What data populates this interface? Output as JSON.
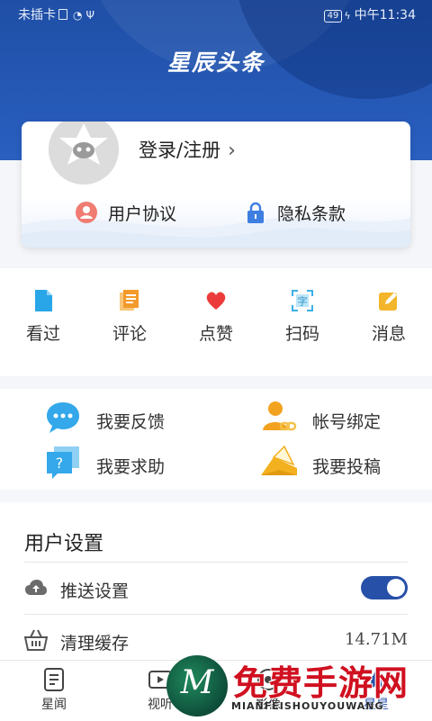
{
  "status_bar": {
    "carrier": "未插卡",
    "battery": "49",
    "time": "中午11:34"
  },
  "header": {
    "logo_text": "星辰头条"
  },
  "profile": {
    "login_label": "登录/注册",
    "links": [
      {
        "label": "用户协议",
        "icon": "user-circle-icon",
        "color": "#f07c72"
      },
      {
        "label": "隐私条款",
        "icon": "lock-icon",
        "color": "#3e7ee0"
      }
    ]
  },
  "quick_actions": [
    {
      "label": "看过",
      "icon": "document-icon",
      "color": "#28a6e8"
    },
    {
      "label": "评论",
      "icon": "comment-doc-icon",
      "color": "#f39a2b"
    },
    {
      "label": "点赞",
      "icon": "heart-icon",
      "color": "#ec3b3b"
    },
    {
      "label": "扫码",
      "icon": "scan-icon",
      "color": "#3ab0e8"
    },
    {
      "label": "消息",
      "icon": "edit-icon",
      "color": "#f3b52b"
    }
  ],
  "services": [
    {
      "label": "我要反馈",
      "icon": "chat-bubble-icon",
      "color": "#34a8ea"
    },
    {
      "label": "帐号绑定",
      "icon": "user-link-icon",
      "color": "#f3a21f"
    },
    {
      "label": "我要求助",
      "icon": "help-icon",
      "color": "#34a8ea"
    },
    {
      "label": "我要投稿",
      "icon": "submit-envelope-icon",
      "color": "#f3b01f"
    }
  ],
  "settings": {
    "title": "用户设置",
    "rows": [
      {
        "label": "推送设置",
        "icon": "cloud-upload-icon",
        "toggle_on": true
      },
      {
        "label": "清理缓存",
        "icon": "basket-icon",
        "value": "14.71M"
      }
    ]
  },
  "tabs": [
    {
      "label": "星闻",
      "icon": "news-icon",
      "active": false
    },
    {
      "label": "视听",
      "icon": "video-icon",
      "active": false
    },
    {
      "label": "影像",
      "icon": "image-icon",
      "active": false
    },
    {
      "label": "星星",
      "icon": "star-icon",
      "active": true
    }
  ],
  "watermark": {
    "title": "免费手游网",
    "subtitle": "MIANFEISHOUYOUWANG",
    "logo_letter": "M"
  },
  "colors": {
    "primary": "#2750a8",
    "header_blue": "#1f4fa6",
    "toggle_on": "#2750a8"
  }
}
